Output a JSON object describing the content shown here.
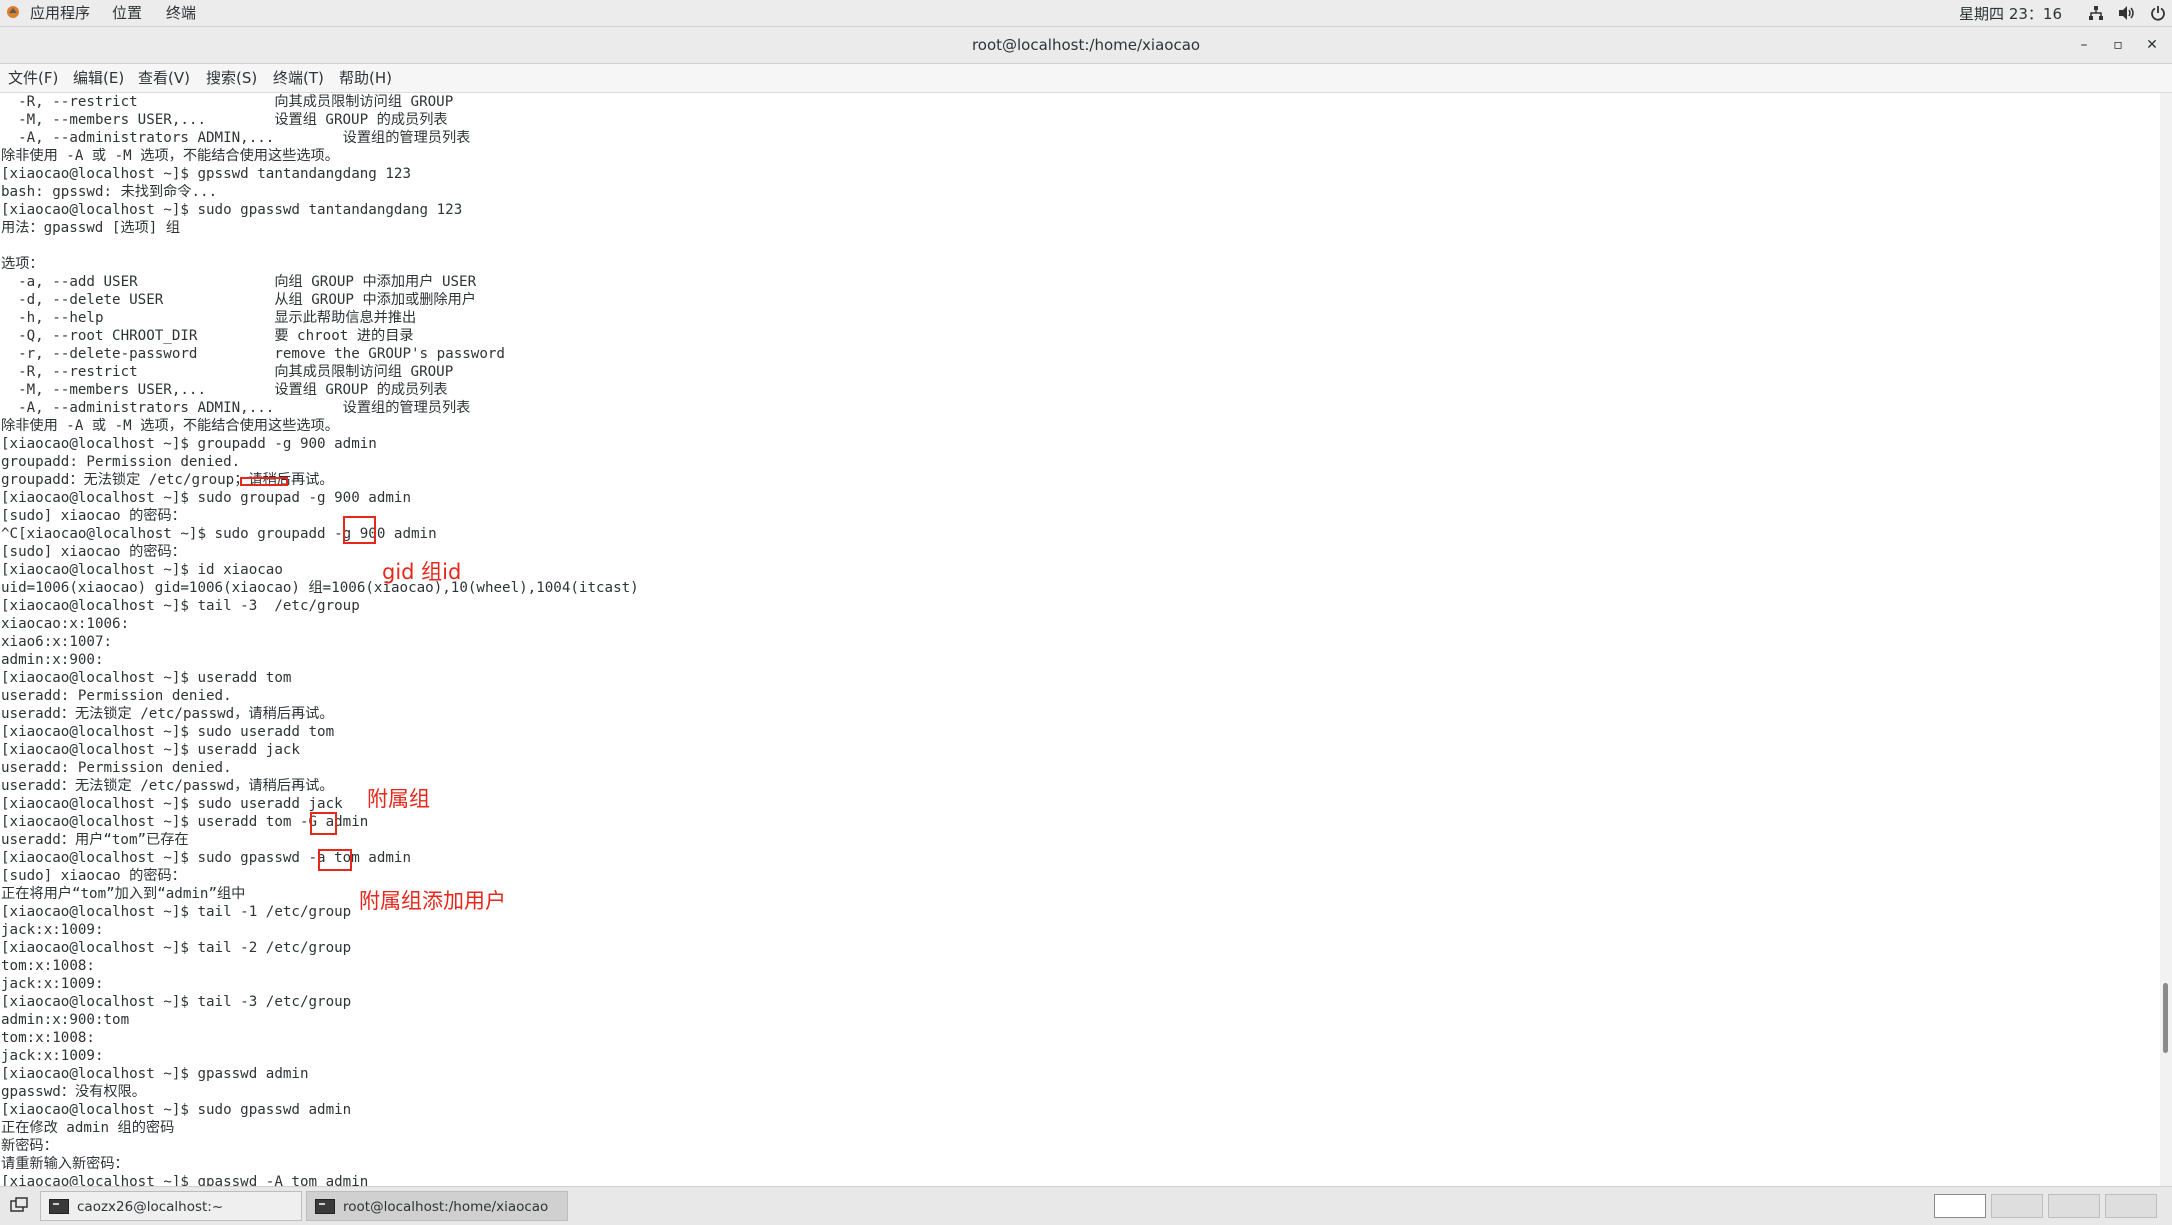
{
  "top_panel": {
    "applications": "应用程序",
    "places": "位置",
    "terminal": "终端",
    "clock": "星期四 23：16",
    "icons": [
      "network-icon",
      "volume-icon",
      "power-icon"
    ]
  },
  "window": {
    "title": "root@localhost:/home/xiaocao",
    "minimize": "–",
    "maximize": "▫",
    "close": "✕"
  },
  "menubar": [
    "文件(F)",
    "编辑(E)",
    "查看(V)",
    "搜索(S)",
    "终端(T)",
    "帮助(H)"
  ],
  "terminal": {
    "lines": [
      "  -R, --restrict                向其成员限制访问组 GROUP",
      "  -M, --members USER,...        设置组 GROUP 的成员列表",
      "  -A, --administrators ADMIN,...        设置组的管理员列表",
      "除非使用 -A 或 -M 选项，不能结合使用这些选项。",
      "[xiaocao@localhost ~]$ gpsswd tantandangdang 123",
      "bash: gpsswd: 未找到命令...",
      "[xiaocao@localhost ~]$ sudo gpasswd tantandangdang 123",
      "用法：gpasswd [选项] 组",
      "",
      "选项：",
      "  -a, --add USER                向组 GROUP 中添加用户 USER",
      "  -d, --delete USER             从组 GROUP 中添加或删除用户",
      "  -h, --help                    显示此帮助信息并推出",
      "  -Q, --root CHROOT_DIR         要 chroot 进的目录",
      "  -r, --delete-password         remove the GROUP's password",
      "  -R, --restrict                向其成员限制访问组 GROUP",
      "  -M, --members USER,...        设置组 GROUP 的成员列表",
      "  -A, --administrators ADMIN,...        设置组的管理员列表",
      "除非使用 -A 或 -M 选项，不能结合使用这些选项。",
      "[xiaocao@localhost ~]$ groupadd -g 900 admin",
      "groupadd: Permission denied.",
      "groupadd：无法锁定 /etc/group；请稍后再试。",
      "[xiaocao@localhost ~]$ sudo groupad -g 900 admin",
      "[sudo] xiaocao 的密码：",
      "^C[xiaocao@localhost ~]$ sudo groupadd -g 900 admin",
      "[sudo] xiaocao 的密码：",
      "[xiaocao@localhost ~]$ id xiaocao",
      "uid=1006(xiaocao) gid=1006(xiaocao) 组=1006(xiaocao),10(wheel),1004(itcast)",
      "[xiaocao@localhost ~]$ tail -3  /etc/group",
      "xiaocao:x:1006:",
      "xiao6:x:1007:",
      "admin:x:900:",
      "[xiaocao@localhost ~]$ useradd tom",
      "useradd: Permission denied.",
      "useradd：无法锁定 /etc/passwd，请稍后再试。",
      "[xiaocao@localhost ~]$ sudo useradd tom",
      "[xiaocao@localhost ~]$ useradd jack",
      "useradd: Permission denied.",
      "useradd：无法锁定 /etc/passwd，请稍后再试。",
      "[xiaocao@localhost ~]$ sudo useradd jack",
      "[xiaocao@localhost ~]$ useradd tom -G admin",
      "useradd：用户“tom”已存在",
      "[xiaocao@localhost ~]$ sudo gpasswd -a tom admin",
      "[sudo] xiaocao 的密码：",
      "正在将用户“tom”加入到“admin”组中",
      "[xiaocao@localhost ~]$ tail -1 /etc/group",
      "jack:x:1009:",
      "[xiaocao@localhost ~]$ tail -2 /etc/group",
      "tom:x:1008:",
      "jack:x:1009:",
      "[xiaocao@localhost ~]$ tail -3 /etc/group",
      "admin:x:900:tom",
      "tom:x:1008:",
      "jack:x:1009:",
      "[xiaocao@localhost ~]$ gpasswd admin",
      "gpasswd：没有权限。",
      "[xiaocao@localhost ~]$ sudo gpasswd admin",
      "正在修改 admin 组的密码",
      "新密码：",
      "请重新输入新密码：",
      "[xiaocao@localhost ~]$ gpasswd -A tom admin"
    ],
    "scroll_position": 0.87
  },
  "annotations": {
    "gid_label": "gid 组id",
    "supplementary_label": "附属组",
    "add_user_label": "附属组添加用户",
    "color": "#e8271b"
  },
  "taskbar": {
    "tasks": [
      "caozx26@localhost:~",
      "root@localhost:/home/xiaocao"
    ],
    "active_task": 1,
    "workspaces": 4,
    "active_workspace": 0
  }
}
